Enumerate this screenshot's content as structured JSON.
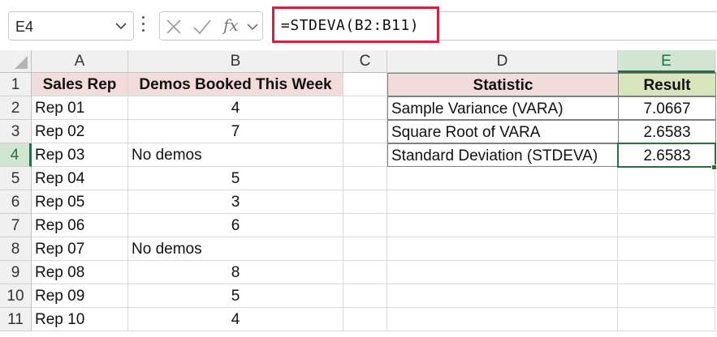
{
  "name_box": {
    "value": "E4"
  },
  "formula_bar": {
    "formula": "=STDEVA(B2:B11)",
    "fx_label": "fx"
  },
  "columns": [
    "A",
    "B",
    "C",
    "D",
    "E"
  ],
  "rows": [
    "1",
    "2",
    "3",
    "4",
    "5",
    "6",
    "7",
    "8",
    "9",
    "10",
    "11"
  ],
  "selected": {
    "column": "E",
    "row": "4"
  },
  "table1": {
    "headers": [
      "Sales Rep",
      "Demos Booked This Week"
    ],
    "data": [
      [
        "Rep 01",
        "4"
      ],
      [
        "Rep 02",
        "7"
      ],
      [
        "Rep 03",
        "No demos"
      ],
      [
        "Rep 04",
        "5"
      ],
      [
        "Rep 05",
        "3"
      ],
      [
        "Rep 06",
        "6"
      ],
      [
        "Rep 07",
        "No demos"
      ],
      [
        "Rep 08",
        "8"
      ],
      [
        "Rep 09",
        "5"
      ],
      [
        "Rep 10",
        "4"
      ]
    ]
  },
  "table2": {
    "headers": [
      "Statistic",
      "Result"
    ],
    "data": [
      [
        "Sample Variance (VARA)",
        "7.0667"
      ],
      [
        "Square Root of VARA",
        "2.6583"
      ],
      [
        "Standard Deviation (STDEVA)",
        "2.6583"
      ]
    ]
  },
  "colors": {
    "accent": "#217346",
    "formula_highlight": "#d4213d",
    "header_pink": "#f2dcdb",
    "header_green": "#d8e4bc"
  }
}
